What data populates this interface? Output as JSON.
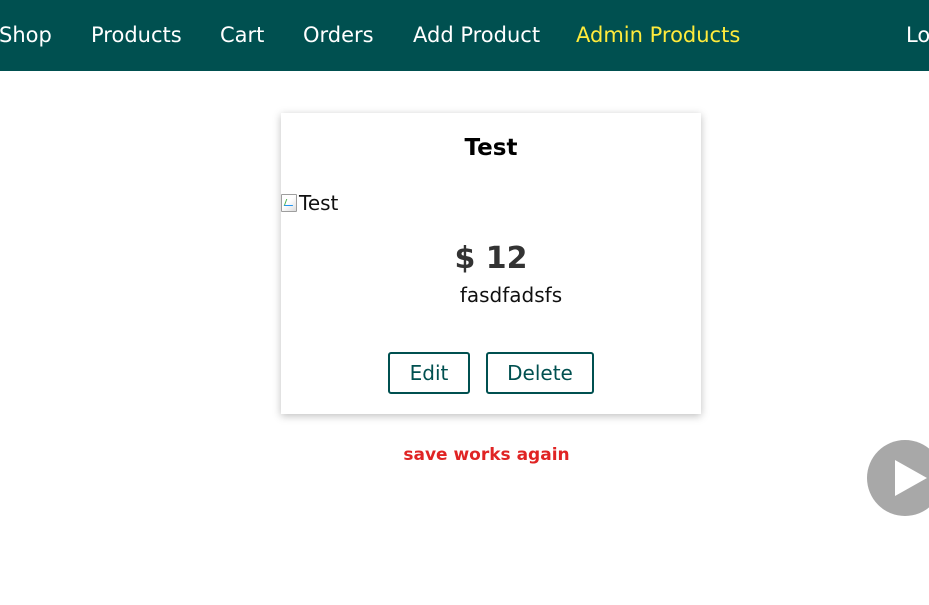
{
  "nav": {
    "items": [
      {
        "label": "Shop",
        "active": false
      },
      {
        "label": "Products",
        "active": false
      },
      {
        "label": "Cart",
        "active": false
      },
      {
        "label": "Orders",
        "active": false
      },
      {
        "label": "Add Product",
        "active": false
      },
      {
        "label": "Admin Products",
        "active": true
      }
    ],
    "logout_label": "Lo"
  },
  "product": {
    "title": "Test",
    "image_alt": "Test",
    "price": "$ 12",
    "description": "fasdfadsfs",
    "edit_label": "Edit",
    "delete_label": "Delete"
  },
  "caption": "save works again",
  "colors": {
    "header_bg": "#005050",
    "active_nav": "#ffeb3b",
    "caption": "#e02424",
    "button_border": "#005050"
  },
  "icons": {
    "image_placeholder": "broken-image-icon",
    "play": "play-icon",
    "cursor": "mouse-cursor"
  }
}
